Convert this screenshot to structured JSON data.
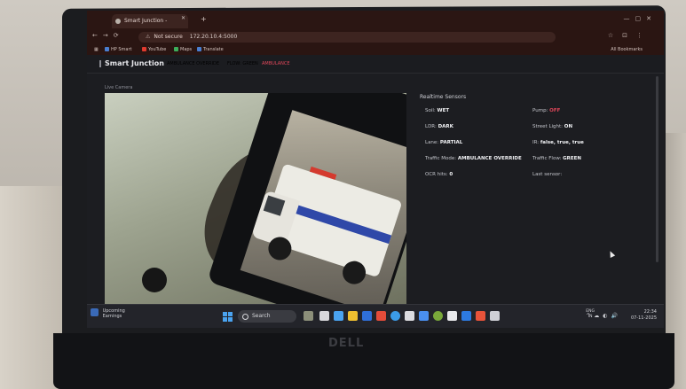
{
  "browser": {
    "tab_title": "Smart Junction - Dashboard",
    "url": "172.20.10.4:5000",
    "security_label": "Not secure",
    "bookmarks": [
      {
        "label": "HP Smart",
        "icon": "hp-icon",
        "color": "#4a7fd1"
      },
      {
        "label": "YouTube",
        "icon": "youtube-icon",
        "color": "#e03a2e"
      },
      {
        "label": "Maps",
        "icon": "maps-icon",
        "color": "#3cae5b"
      },
      {
        "label": "Translate",
        "icon": "translate-icon",
        "color": "#4a7fd1"
      }
    ],
    "all_bookmarks": "All Bookmarks"
  },
  "app": {
    "brand": "Smart Junction",
    "badges": [
      {
        "text": "AMBULANCE OVERRIDE",
        "color": "#c8c9cf"
      },
      {
        "text": "FLOW: GREEN",
        "color": "#c8c9cf"
      },
      {
        "text": "AMBULANCE",
        "color": "#e0475a"
      }
    ]
  },
  "camera": {
    "title": "Live Camera"
  },
  "readings": {
    "title": "Realtime Sensors",
    "left": [
      {
        "label": "Soil:",
        "value": "WET",
        "color": "#f1f2f5"
      },
      {
        "label": "LDR:",
        "value": "DARK",
        "color": "#f1f2f5"
      },
      {
        "label": "Lane:",
        "value": "PARTIAL",
        "color": "#f1f2f5"
      },
      {
        "label": "Traffic Mode:",
        "value": "AMBULANCE OVERRIDE",
        "color": "#f1f2f5"
      },
      {
        "label": "OCR hits:",
        "value": "0",
        "color": "#f1f2f5"
      }
    ],
    "right": [
      {
        "label": "Pump:",
        "value": "OFF",
        "color": "#e0475a"
      },
      {
        "label": "Street Light:",
        "value": "ON",
        "color": "#f1f2f5"
      },
      {
        "label": "IR:",
        "value": "false, true, true",
        "color": "#f1f2f5"
      },
      {
        "label": "Traffic Flow:",
        "value": "GREEN",
        "color": "#f1f2f5"
      },
      {
        "label": "Last sensor:",
        "value": "",
        "color": "#f1f2f5"
      }
    ]
  },
  "taskbar": {
    "weather_line1": "Upcoming",
    "weather_line2": "Earnings",
    "search_placeholder": "Search",
    "lang_line1": "ENG",
    "lang_line2": "IN",
    "time": "22:34",
    "date": "07-11-2025"
  },
  "laptop": {
    "logo": "DELL"
  }
}
